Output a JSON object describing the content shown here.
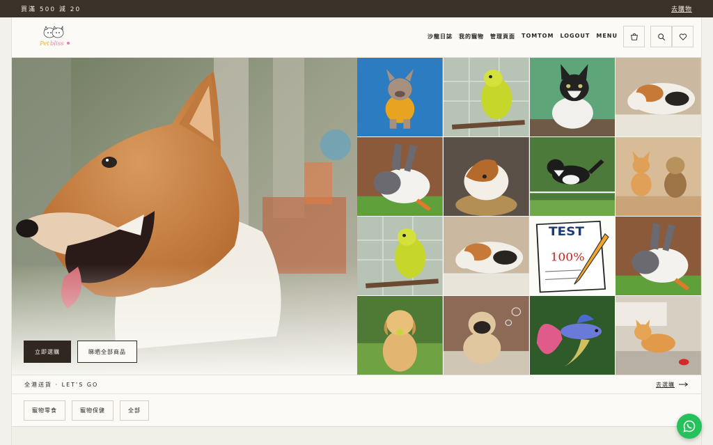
{
  "promo": {
    "text": "買滿 500 減 20",
    "link": "去購物"
  },
  "header": {
    "logo_icon": "petbliss-logo-icon",
    "nav": [
      "沙龍日誌",
      "我的寵物",
      "管理頁面",
      "TOMTOM",
      "LOGOUT",
      "MENU"
    ],
    "icons": [
      "cart-icon",
      "search-icon",
      "heart-icon"
    ]
  },
  "hero": {
    "cta_primary": "立即選購",
    "cta_secondary": "睇晒全部商品"
  },
  "grid": {
    "tiles": [
      "french-bulldog",
      "budgie",
      "tuxedo-cat",
      "calico-cat",
      "rabbit",
      "guinea-pig",
      "border-collie",
      "corgi-yorkie",
      "budgie",
      "calico-cat",
      "test-100-paper",
      "rabbit",
      "golden-retriever",
      "pug",
      "betta-fish",
      "orange-kitten"
    ]
  },
  "strip": {
    "left": "全港送貨 · LET'S GO",
    "right": "去選購"
  },
  "categories": [
    "寵物零食",
    "寵物保健",
    "全部"
  ],
  "colors": {
    "dark": "#3a3128",
    "accent": "#25c15a",
    "background": "#fbfaf6"
  }
}
